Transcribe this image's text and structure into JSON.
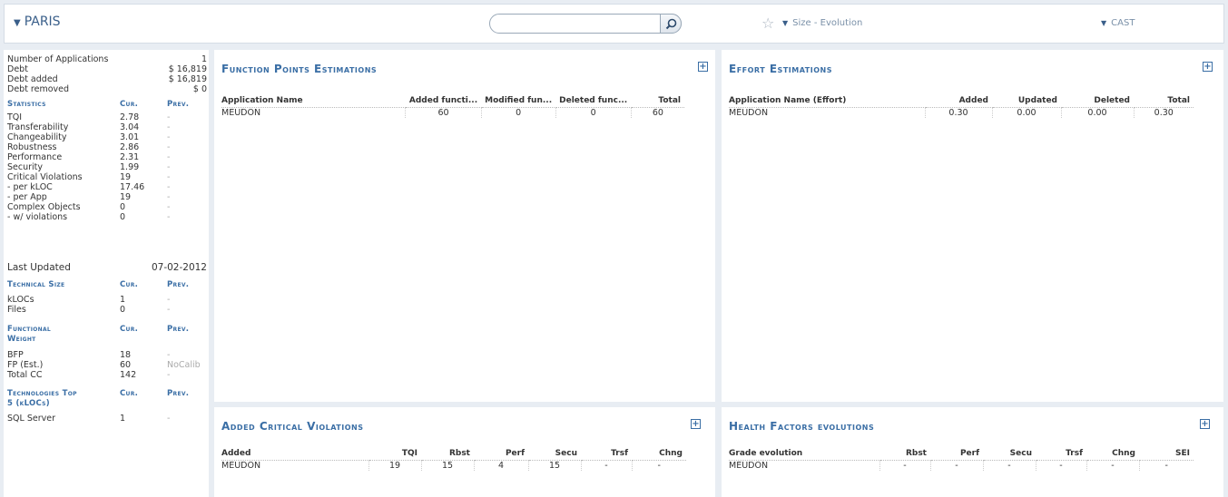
{
  "header": {
    "title": "PARIS",
    "search_placeholder": "",
    "size_dropdown": "Size - Evolution",
    "cast_dropdown": "CAST"
  },
  "summary": {
    "num_apps_label": "Number of Applications",
    "num_apps": "1",
    "debt_label": "Debt",
    "debt": "$ 16,819",
    "debt_added_label": "Debt added",
    "debt_added": "$ 16,819",
    "debt_removed_label": "Debt removed",
    "debt_removed": "$ 0"
  },
  "statistics": {
    "head": "Statistics",
    "cur": "Cur.",
    "prev": "Prev.",
    "rows": [
      {
        "label": "TQI",
        "cur": "2.78",
        "prev": "-"
      },
      {
        "label": "Transferability",
        "cur": "3.04",
        "prev": "-"
      },
      {
        "label": "Changeability",
        "cur": "3.01",
        "prev": "-"
      },
      {
        "label": "Robustness",
        "cur": "2.86",
        "prev": "-"
      },
      {
        "label": "Performance",
        "cur": "2.31",
        "prev": "-"
      },
      {
        "label": "Security",
        "cur": "1.99",
        "prev": "-"
      },
      {
        "label": "Critical Violations",
        "cur": "19",
        "prev": "-"
      },
      {
        "label": "- per kLOC",
        "cur": "17.46",
        "prev": "-"
      },
      {
        "label": "- per App",
        "cur": "19",
        "prev": "-"
      },
      {
        "label": "Complex Objects",
        "cur": "0",
        "prev": "-"
      },
      {
        "label": "- w/ violations",
        "cur": "0",
        "prev": "-"
      }
    ],
    "last_updated_label": "Last Updated",
    "last_updated": "07-02-2012"
  },
  "technical_size": {
    "head": "Technical Size",
    "cur": "Cur.",
    "prev": "Prev.",
    "rows": [
      {
        "label": "kLOCs",
        "cur": "1",
        "prev": "-"
      },
      {
        "label": "Files",
        "cur": "0",
        "prev": "-"
      }
    ]
  },
  "functional_weight": {
    "head1": "Functional",
    "head2": "Weight",
    "cur": "Cur.",
    "prev": "Prev.",
    "rows": [
      {
        "label": "BFP",
        "cur": "18",
        "prev": "-"
      },
      {
        "label": "FP (Est.)",
        "cur": "60",
        "prev": "NoCalib"
      },
      {
        "label": "Total CC",
        "cur": "142",
        "prev": "-"
      }
    ]
  },
  "technologies": {
    "head1": "Technologies Top",
    "head2": "5 (kLOCs)",
    "cur": "Cur.",
    "prev": "Prev.",
    "rows": [
      {
        "label": "SQL Server",
        "cur": "1",
        "prev": "-"
      }
    ]
  },
  "fp_panel": {
    "title": "Function Points Estimations",
    "headers": [
      "Application Name",
      "Added functi...",
      "Modified fun...",
      "Deleted func...",
      "Total"
    ],
    "rows": [
      [
        "MEUDON",
        "60",
        "0",
        "0",
        "60"
      ]
    ]
  },
  "effort_panel": {
    "title": "Effort Estimations",
    "headers": [
      "Application Name (Effort)",
      "Added",
      "Updated",
      "Deleted",
      "Total"
    ],
    "rows": [
      [
        "MEUDON",
        "0.30",
        "0.00",
        "0.00",
        "0.30"
      ]
    ]
  },
  "acv_panel": {
    "title": "Added Critical Violations",
    "headers": [
      "Added",
      "TQI",
      "Rbst",
      "Perf",
      "Secu",
      "Trsf",
      "Chng"
    ],
    "rows": [
      [
        "MEUDON",
        "19",
        "15",
        "4",
        "15",
        "-",
        "-"
      ]
    ]
  },
  "hf_panel": {
    "title": "Health Factors evolutions",
    "headers": [
      "Grade evolution",
      "Rbst",
      "Perf",
      "Secu",
      "Trsf",
      "Chng",
      "SEI"
    ],
    "rows": [
      [
        "MEUDON",
        "-",
        "-",
        "-",
        "-",
        "-",
        "-"
      ]
    ]
  }
}
